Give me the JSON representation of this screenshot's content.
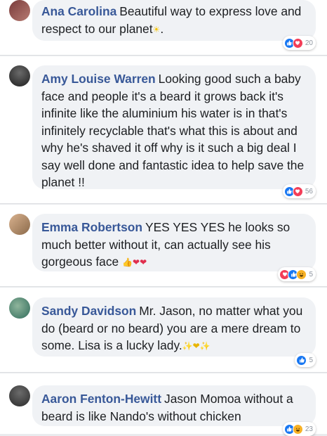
{
  "comments": [
    {
      "author": "Ana Carolina",
      "text": "Beautiful way to express love and respect to our planet",
      "trailing_emoji": "☀",
      "after_emoji": ".",
      "reaction_count": "20",
      "avatar_colors": [
        "#7a3b3b",
        "#b67b72"
      ]
    },
    {
      "author": "Amy Louise Warren",
      "text": "Looking good such a baby face and people it's a beard it grows back it's infinite like the aluminium his water is in that's infinitely recyclable that's what this is about and why he's shaved it off why is it such a big deal I say well done and fantastic idea to help save the planet !!",
      "reaction_count": "56",
      "avatar_colors": [
        "#1e1e1e",
        "#4a4a4a"
      ]
    },
    {
      "author": "Emma Robertson",
      "text": "YES YES YES he looks so much better without it, can actually see his gorgeous face",
      "trailing_emoji": "👍❤❤",
      "reaction_count": "5",
      "avatar_colors": [
        "#8b6a4a",
        "#d9b28f"
      ]
    },
    {
      "author": "Sandy Davidson",
      "text": "Mr. Jason, no matter what you do (beard or no beard) you are a mere dream to some. Lisa is a lucky lady.",
      "trailing_emoji": "✨❤✨",
      "reaction_count": "5",
      "avatar_colors": [
        "#2f6b5a",
        "#8fb59c"
      ]
    },
    {
      "author": "Aaron Fenton-Hewitt",
      "text": "Jason Momoa without a beard is like Nando's without chicken",
      "reaction_count": "23",
      "avatar_colors": [
        "#2a2a2a",
        "#6b6b6b"
      ]
    }
  ],
  "icons": {
    "like": "👍",
    "love": "❤",
    "haha": "😆"
  }
}
